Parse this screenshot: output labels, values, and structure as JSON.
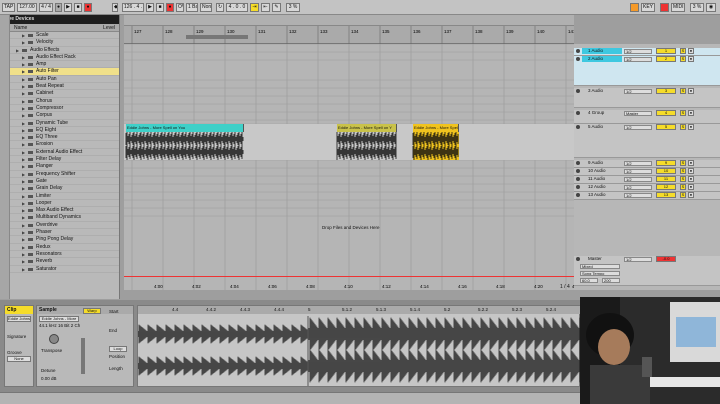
{
  "transport": {
    "tap": "TAP",
    "tempo": "127.00",
    "signature": "4 / 4",
    "quantize": "1 Bar",
    "position": "126 . 4 . 1",
    "loop_length": "4 . 0 . 0",
    "key": "KEY",
    "midi": "MIDI",
    "cpu": "3 %",
    "draw": "OVR",
    "mode": "None"
  },
  "browser": {
    "header": "Live Devices",
    "col_name": "Name",
    "col_level": "Level",
    "items": [
      {
        "label": "Scale",
        "type": "item"
      },
      {
        "label": "Velocity",
        "type": "item"
      },
      {
        "label": "Audio Effects",
        "type": "folder"
      },
      {
        "label": "Audio Effect Rack",
        "type": "item"
      },
      {
        "label": "Amp",
        "type": "item"
      },
      {
        "label": "Auto Filter",
        "type": "item",
        "selected": true
      },
      {
        "label": "Auto Pan",
        "type": "item"
      },
      {
        "label": "Beat Repeat",
        "type": "item"
      },
      {
        "label": "Cabinet",
        "type": "item"
      },
      {
        "label": "Chorus",
        "type": "item"
      },
      {
        "label": "Compressor",
        "type": "item"
      },
      {
        "label": "Corpus",
        "type": "item"
      },
      {
        "label": "Dynamic Tube",
        "type": "item"
      },
      {
        "label": "EQ Eight",
        "type": "item"
      },
      {
        "label": "EQ Three",
        "type": "item"
      },
      {
        "label": "Erosion",
        "type": "item"
      },
      {
        "label": "External Audio Effect",
        "type": "item"
      },
      {
        "label": "Filter Delay",
        "type": "item"
      },
      {
        "label": "Flanger",
        "type": "item"
      },
      {
        "label": "Frequency Shifter",
        "type": "item"
      },
      {
        "label": "Gate",
        "type": "item"
      },
      {
        "label": "Grain Delay",
        "type": "item"
      },
      {
        "label": "Limiter",
        "type": "item"
      },
      {
        "label": "Looper",
        "type": "item"
      },
      {
        "label": "Max Audio Effect",
        "type": "item"
      },
      {
        "label": "Multiband Dynamics",
        "type": "item"
      },
      {
        "label": "Overdrive",
        "type": "item"
      },
      {
        "label": "Phaser",
        "type": "item"
      },
      {
        "label": "Ping Pong Delay",
        "type": "item"
      },
      {
        "label": "Redux",
        "type": "item"
      },
      {
        "label": "Resonators",
        "type": "item"
      },
      {
        "label": "Reverb",
        "type": "item"
      },
      {
        "label": "Saturator",
        "type": "item"
      }
    ]
  },
  "arrangement": {
    "ruler_bars": [
      "127",
      "128",
      "129",
      "130",
      "131",
      "132",
      "133",
      "134",
      "135",
      "136",
      "137",
      "138",
      "139",
      "140",
      "141"
    ],
    "time_marks": [
      "4:00",
      "4:02",
      "4:04",
      "4:06",
      "4:08",
      "4:10",
      "4:12",
      "4:14",
      "4:16",
      "4:18",
      "4:20",
      "4:22"
    ],
    "drop_text": "Drop Files and Devices Here",
    "page": "1 / 4",
    "clips": [
      {
        "label": "Eddie Johns - More Spell on You",
        "color": "#3fd0c8"
      },
      {
        "label": "Eddie Johns - More Spell on Y",
        "color": "#c9c24a"
      },
      {
        "label": "Eddie Johns - More Spell",
        "color": "#f0c31e"
      }
    ]
  },
  "mixer": {
    "tracks": [
      {
        "name": "1 Audio",
        "input": "1/2",
        "num": "1",
        "hl": true
      },
      {
        "name": "2 Audio",
        "input": "1/2",
        "num": "2",
        "hl": true
      },
      {
        "name": "3 Audio",
        "input": "1/2",
        "num": "3"
      },
      {
        "name": "4 Group",
        "input": "Master",
        "num": "4"
      },
      {
        "name": "5 Audio",
        "input": "1/2",
        "num": "5"
      },
      {
        "name": "9 Audio",
        "input": "1/2",
        "num": "9"
      },
      {
        "name": "10 Audio",
        "input": "1/2",
        "num": "10"
      },
      {
        "name": "11 Audio",
        "input": "1/2",
        "num": "11"
      },
      {
        "name": "12 Audio",
        "input": "1/2",
        "num": "12"
      },
      {
        "name": "13 Audio",
        "input": "1/2",
        "num": "13"
      }
    ],
    "master": {
      "name": "Master",
      "input": "1/2",
      "value": "-0.0",
      "mix": "Mixed",
      "tempo": "Song Tempo",
      "bpm1": "60.0",
      "bpm2": "200"
    }
  },
  "clip_view": {
    "title": "Clip",
    "clip_name": "Eddie Johns",
    "signature_label": "Signature",
    "groove_label": "Groove",
    "groove": "None",
    "sample_title": "Sample",
    "sample_file": "Eddie Johns - More",
    "sample_info": "44.1 kHz 16 Bit 2 Ch",
    "warp": "Warp",
    "start": "Start",
    "end": "End",
    "loop": "Loop",
    "position": "Position",
    "length": "Length",
    "transpose": "Transpose",
    "detune": "Detune",
    "gain": "0.00 dB",
    "markers": [
      "4.4",
      "4.4.2",
      "4.4.3",
      "4.4.4",
      "5",
      "5.1.2",
      "5.1.3",
      "5.1.4",
      "5.2",
      "5.2.2",
      "5.2.3",
      "5.2.4"
    ]
  }
}
